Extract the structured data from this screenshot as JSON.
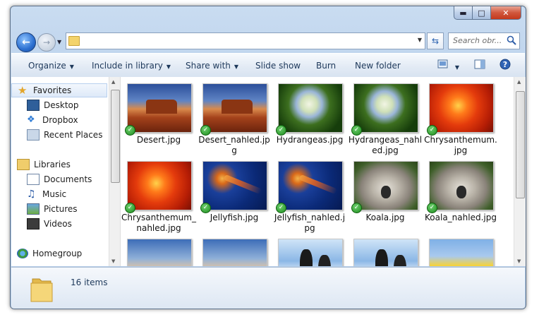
{
  "window": {
    "minimize_icon": "minimize-icon",
    "maximize_icon": "maximize-icon",
    "close_icon": "close-icon"
  },
  "address": {
    "path": "",
    "search_placeholder": "Search obr..."
  },
  "toolbar": {
    "organize": "Organize",
    "include_in_library": "Include in library",
    "share_with": "Share with",
    "slide_show": "Slide show",
    "burn": "Burn",
    "new_folder": "New folder"
  },
  "nav": {
    "favorites": "Favorites",
    "desktop": "Desktop",
    "dropbox": "Dropbox",
    "recent_places": "Recent Places",
    "libraries": "Libraries",
    "documents": "Documents",
    "music": "Music",
    "pictures": "Pictures",
    "videos": "Videos",
    "homegroup": "Homegroup"
  },
  "files": [
    {
      "name": "Desert.jpg",
      "thumb": "desert",
      "synced": true
    },
    {
      "name": "Desert_nahled.jpg",
      "thumb": "desert",
      "synced": true
    },
    {
      "name": "Hydrangeas.jpg",
      "thumb": "hydra",
      "synced": true
    },
    {
      "name": "Hydrangeas_nahled.jpg",
      "thumb": "hydra",
      "synced": true
    },
    {
      "name": "Chrysanthemum.jpg",
      "thumb": "chrys",
      "synced": true
    },
    {
      "name": "Chrysanthemum_nahled.jpg",
      "thumb": "chrys",
      "synced": true
    },
    {
      "name": "Jellyfish.jpg",
      "thumb": "jelly",
      "synced": true
    },
    {
      "name": "Jellyfish_nahled.jpg",
      "thumb": "jelly",
      "synced": true
    },
    {
      "name": "Koala.jpg",
      "thumb": "koala",
      "synced": true
    },
    {
      "name": "Koala_nahled.jpg",
      "thumb": "koala",
      "synced": true
    },
    {
      "name": "",
      "thumb": "light",
      "synced": false
    },
    {
      "name": "",
      "thumb": "light",
      "synced": false
    },
    {
      "name": "",
      "thumb": "peng",
      "synced": false
    },
    {
      "name": "",
      "thumb": "peng",
      "synced": false
    },
    {
      "name": "",
      "thumb": "tulip",
      "synced": false
    }
  ],
  "status": {
    "count": "16 items"
  }
}
